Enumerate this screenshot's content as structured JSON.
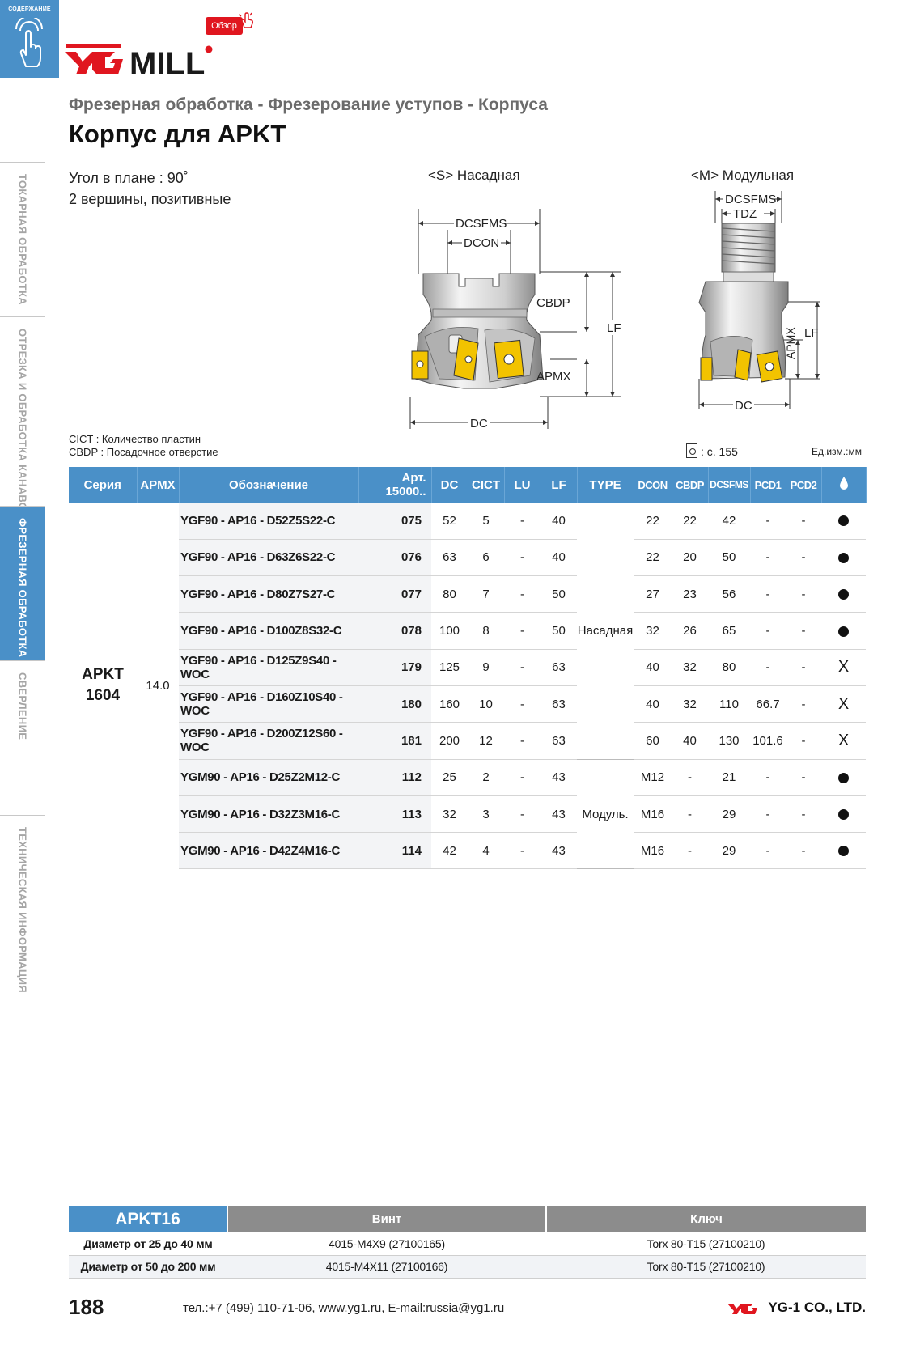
{
  "nav": {
    "toc_label": "СОДЕРЖАНИЕ",
    "tabs": [
      {
        "label": "ТОКАРНАЯ ОБРАБОТКА",
        "active": false
      },
      {
        "label": "ОТРЕЗКА И ОБРАБОТКА КАНАВОК",
        "active": false
      },
      {
        "label": "ФРЕЗЕРНАЯ ОБРАБОТКА",
        "active": true
      },
      {
        "label": "СВЕРЛЕНИЕ",
        "active": false
      },
      {
        "label": "ТЕХНИЧЕСКАЯ ИНФОРМАЦИЯ",
        "active": false
      }
    ]
  },
  "header": {
    "brand": "YG MILL",
    "overview_button": "Обзор",
    "subtitle": "Фрезерная обработка - Фрезерование уступов - Корпуса",
    "title": "Корпус для APKT"
  },
  "specs": {
    "angle": "Угол в плане : 90˚",
    "edges": "2 вершины, позитивные"
  },
  "drawings": {
    "s_label": "<S> Насадная",
    "m_label": "<M> Модульная",
    "s_dims": {
      "dcsfms": "DCSFMS",
      "dcon": "DCON",
      "cbdp": "CBDP",
      "lf": "LF",
      "apmx": "APMX",
      "dc": "DC"
    },
    "m_dims": {
      "dcsfms": "DCSFMS",
      "tdz": "TDZ",
      "apmx": "APMX",
      "lf": "LF",
      "dc": "DC"
    }
  },
  "legend": {
    "cict": "CICT : Количество пластин",
    "cbdp": "CBDP : Посадочное отверстие",
    "page_ref": ": с. 155",
    "units": "Ед.изм.:мм"
  },
  "table": {
    "headers": {
      "series": "Серия",
      "apmx": "APMX",
      "designation": "Обозначение",
      "art1": "Арт.",
      "art2": "15000..",
      "dc": "DC",
      "cict": "CICT",
      "lu": "LU",
      "lf": "LF",
      "type": "TYPE",
      "dcon": "DCON",
      "cbdp": "CBDP",
      "dcsfms": "DCSFMS",
      "pcd1": "PCD1",
      "pcd2": "PCD2"
    },
    "series1": "APKT",
    "series2": "1604",
    "apmx_value": "14.0",
    "type_s": "Насадная",
    "type_m": "Модуль.",
    "rows": [
      {
        "designation": "YGF90 - AP16 - D52Z5S22-C",
        "art": "075",
        "dc": "52",
        "cict": "5",
        "lu": "-",
        "lf": "40",
        "dcon": "22",
        "cbdp": "22",
        "dcsfms": "42",
        "pcd1": "-",
        "pcd2": "-",
        "coolant": "●"
      },
      {
        "designation": "YGF90 - AP16 - D63Z6S22-C",
        "art": "076",
        "dc": "63",
        "cict": "6",
        "lu": "-",
        "lf": "40",
        "dcon": "22",
        "cbdp": "20",
        "dcsfms": "50",
        "pcd1": "-",
        "pcd2": "-",
        "coolant": "●"
      },
      {
        "designation": "YGF90 - AP16 - D80Z7S27-C",
        "art": "077",
        "dc": "80",
        "cict": "7",
        "lu": "-",
        "lf": "50",
        "dcon": "27",
        "cbdp": "23",
        "dcsfms": "56",
        "pcd1": "-",
        "pcd2": "-",
        "coolant": "●"
      },
      {
        "designation": "YGF90 - AP16 - D100Z8S32-C",
        "art": "078",
        "dc": "100",
        "cict": "8",
        "lu": "-",
        "lf": "50",
        "dcon": "32",
        "cbdp": "26",
        "dcsfms": "65",
        "pcd1": "-",
        "pcd2": "-",
        "coolant": "●"
      },
      {
        "designation": "YGF90 - AP16 - D125Z9S40 - WOC",
        "art": "179",
        "dc": "125",
        "cict": "9",
        "lu": "-",
        "lf": "63",
        "dcon": "40",
        "cbdp": "32",
        "dcsfms": "80",
        "pcd1": "-",
        "pcd2": "-",
        "coolant": "X"
      },
      {
        "designation": "YGF90 - AP16 - D160Z10S40 - WOC",
        "art": "180",
        "dc": "160",
        "cict": "10",
        "lu": "-",
        "lf": "63",
        "dcon": "40",
        "cbdp": "32",
        "dcsfms": "110",
        "pcd1": "66.7",
        "pcd2": "-",
        "coolant": "X"
      },
      {
        "designation": "YGF90 - AP16 - D200Z12S60 - WOC",
        "art": "181",
        "dc": "200",
        "cict": "12",
        "lu": "-",
        "lf": "63",
        "dcon": "60",
        "cbdp": "40",
        "dcsfms": "130",
        "pcd1": "101.6",
        "pcd2": "-",
        "coolant": "X"
      },
      {
        "designation": "YGM90 - AP16 - D25Z2M12-C",
        "art": "112",
        "dc": "25",
        "cict": "2",
        "lu": "-",
        "lf": "43",
        "dcon": "M12",
        "cbdp": "-",
        "dcsfms": "21",
        "pcd1": "-",
        "pcd2": "-",
        "coolant": "●"
      },
      {
        "designation": "YGM90 - AP16 - D32Z3M16-C",
        "art": "113",
        "dc": "32",
        "cict": "3",
        "lu": "-",
        "lf": "43",
        "dcon": "M16",
        "cbdp": "-",
        "dcsfms": "29",
        "pcd1": "-",
        "pcd2": "-",
        "coolant": "●"
      },
      {
        "designation": "YGM90 - AP16 - D42Z4M16-C",
        "art": "114",
        "dc": "42",
        "cict": "4",
        "lu": "-",
        "lf": "43",
        "dcon": "M16",
        "cbdp": "-",
        "dcsfms": "29",
        "pcd1": "-",
        "pcd2": "-",
        "coolant": "●"
      }
    ]
  },
  "accessories": {
    "series": "APKT16",
    "screw_header": "Винт",
    "key_header": "Ключ",
    "rows": [
      {
        "label": "Диаметр от 25 до 40 мм",
        "screw": "4015-M4X9 (27100165)",
        "key": "Torx 80-T15 (27100210)"
      },
      {
        "label": "Диаметр от 50 до 200 мм",
        "screw": "4015-M4X11 (27100166)",
        "key": "Torx 80-T15 (27100210)"
      }
    ]
  },
  "footer": {
    "page": "188",
    "contact": "тел.:+7 (499) 110-71-06, www.yg1.ru, E-mail:russia@yg1.ru",
    "company": "YG-1 CO., LTD."
  },
  "colors": {
    "accent": "#4a90c8",
    "brand_red": "#e0161f",
    "insert_yellow": "#f2c300",
    "header_gray": "#8c8c8c"
  }
}
